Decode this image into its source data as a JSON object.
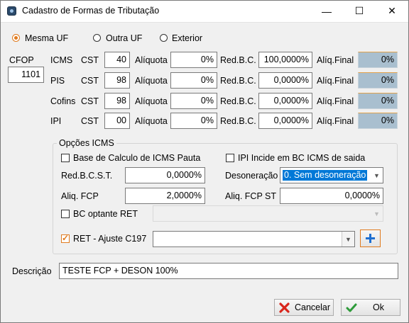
{
  "window": {
    "title": "Cadastro de Formas de Tributação",
    "minimize": "—",
    "maximize": "☐",
    "close": "✕"
  },
  "scope": {
    "options": [
      "Mesma UF",
      "Outra UF",
      "Exterior"
    ],
    "selected": "Mesma UF"
  },
  "cfop": {
    "label": "CFOP",
    "value": "1101"
  },
  "taxes": [
    {
      "name": "ICMS",
      "cst_label": "CST",
      "cst": "40",
      "aliquota_label": "Alíquota",
      "aliquota": "0%",
      "redbc_label": "Red.B.C.",
      "redbc": "100,0000%",
      "aliq_final_label": "Alíq.Final",
      "aliq_final": "0%"
    },
    {
      "name": "PIS",
      "cst_label": "CST",
      "cst": "98",
      "aliquota_label": "Alíquota",
      "aliquota": "0%",
      "redbc_label": "Red.B.C.",
      "redbc": "0,0000%",
      "aliq_final_label": "Alíq.Final",
      "aliq_final": "0%"
    },
    {
      "name": "Cofins",
      "cst_label": "CST",
      "cst": "98",
      "aliquota_label": "Alíquota",
      "aliquota": "0%",
      "redbc_label": "Red.B.C.",
      "redbc": "0,0000%",
      "aliq_final_label": "Alíq.Final",
      "aliq_final": "0%"
    },
    {
      "name": "IPI",
      "cst_label": "CST",
      "cst": "00",
      "aliquota_label": "Alíquota",
      "aliquota": "0%",
      "redbc_label": "Red.B.C.",
      "redbc": "0,0000%",
      "aliq_final_label": "Alíq.Final",
      "aliq_final": "0%"
    }
  ],
  "icms_options": {
    "title": "Opções ICMS",
    "base_calc_pauta_label": "Base de Calculo de ICMS Pauta",
    "base_calc_pauta_checked": false,
    "ipi_incide_label": "IPI Incide em BC ICMS de saida",
    "ipi_incide_checked": false,
    "red_bcst_label": "Red.B.C.S.T.",
    "red_bcst": "0,0000%",
    "desoneracao_label": "Desoneração",
    "desoneracao": "0. Sem desoneração",
    "aliq_fcp_label": "Aliq. FCP",
    "aliq_fcp": "2,0000%",
    "aliq_fcp_st_label": "Aliq. FCP ST",
    "aliq_fcp_st": "0,0000%",
    "bc_optante_ret_label": "BC optante RET",
    "bc_optante_ret_checked": false,
    "bc_optante_ret_value": "",
    "ret_ajuste_label": "RET - Ajuste C197",
    "ret_ajuste_checked": true,
    "ret_ajuste_value": ""
  },
  "descricao": {
    "label": "Descrição",
    "value": "TESTE FCP + DESON 100%"
  },
  "buttons": {
    "cancel": "Cancelar",
    "ok": "Ok"
  },
  "colors": {
    "accent": "#e07b1f",
    "readonly_bg": "#a9bfcf",
    "selection": "#0078d7",
    "cancel_icon": "#d9261c",
    "ok_icon": "#2e9b3a",
    "add_icon": "#1f6fd1"
  }
}
